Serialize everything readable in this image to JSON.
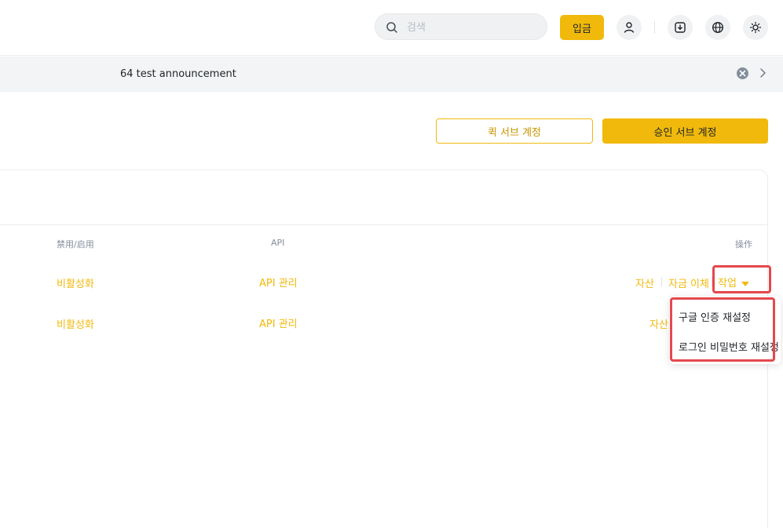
{
  "header": {
    "search": {
      "placeholder": "검색",
      "value": ""
    },
    "deposit_label": "입금",
    "icons": [
      "user-icon",
      "download-icon",
      "globe-icon",
      "sun-icon"
    ]
  },
  "announcement": {
    "text": "64 test announcement"
  },
  "actions": {
    "quick_sub_account": "퀵 서브 계정",
    "approved_sub_account": "승인 서브 계정"
  },
  "table": {
    "columns": {
      "status": "禁用/启用",
      "api": "API",
      "actions": "操作"
    },
    "rows": [
      {
        "status": "비활성화",
        "api": "API 관리",
        "assets": "자산",
        "transfer": "자금 이체",
        "operation": "작업"
      },
      {
        "status": "비활성화",
        "api": "API 관리",
        "assets": "자산"
      }
    ]
  },
  "dropdown": {
    "items": [
      "구글 인증 재설정",
      "로그인 비밀번호 재설정"
    ]
  },
  "colors": {
    "accent": "#f0b90b",
    "highlight": "#e5484d",
    "text": "#1e2329",
    "muted": "#848e9c"
  }
}
